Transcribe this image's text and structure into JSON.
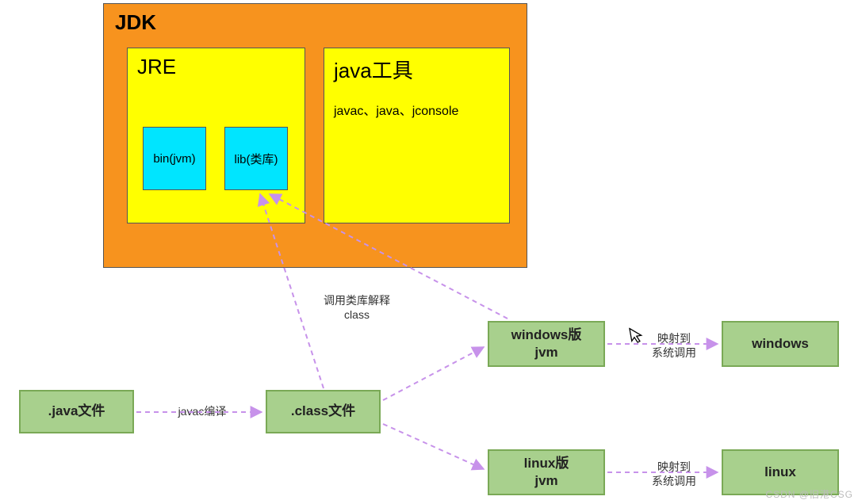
{
  "jdk": {
    "title": "JDK",
    "jre": {
      "title": "JRE",
      "bin": "bin(jvm)",
      "lib": "lib(类库)"
    },
    "tools": {
      "title": "java工具",
      "list": "javac、java、jconsole"
    }
  },
  "flow": {
    "java_file": ".java文件",
    "javac_label": "javac编译",
    "class_file": ".class文件",
    "lib_label_line1": "调用类库解释",
    "lib_label_line2": "class",
    "win_jvm_line1": "windows版",
    "win_jvm_line2": "jvm",
    "linux_jvm_line1": "linux版",
    "linux_jvm_line2": "jvm",
    "map_label_line1": "映射到",
    "map_label_line2": "系统调用",
    "windows": "windows",
    "linux": "linux"
  },
  "watermark": "CSDN @旧港CSG"
}
